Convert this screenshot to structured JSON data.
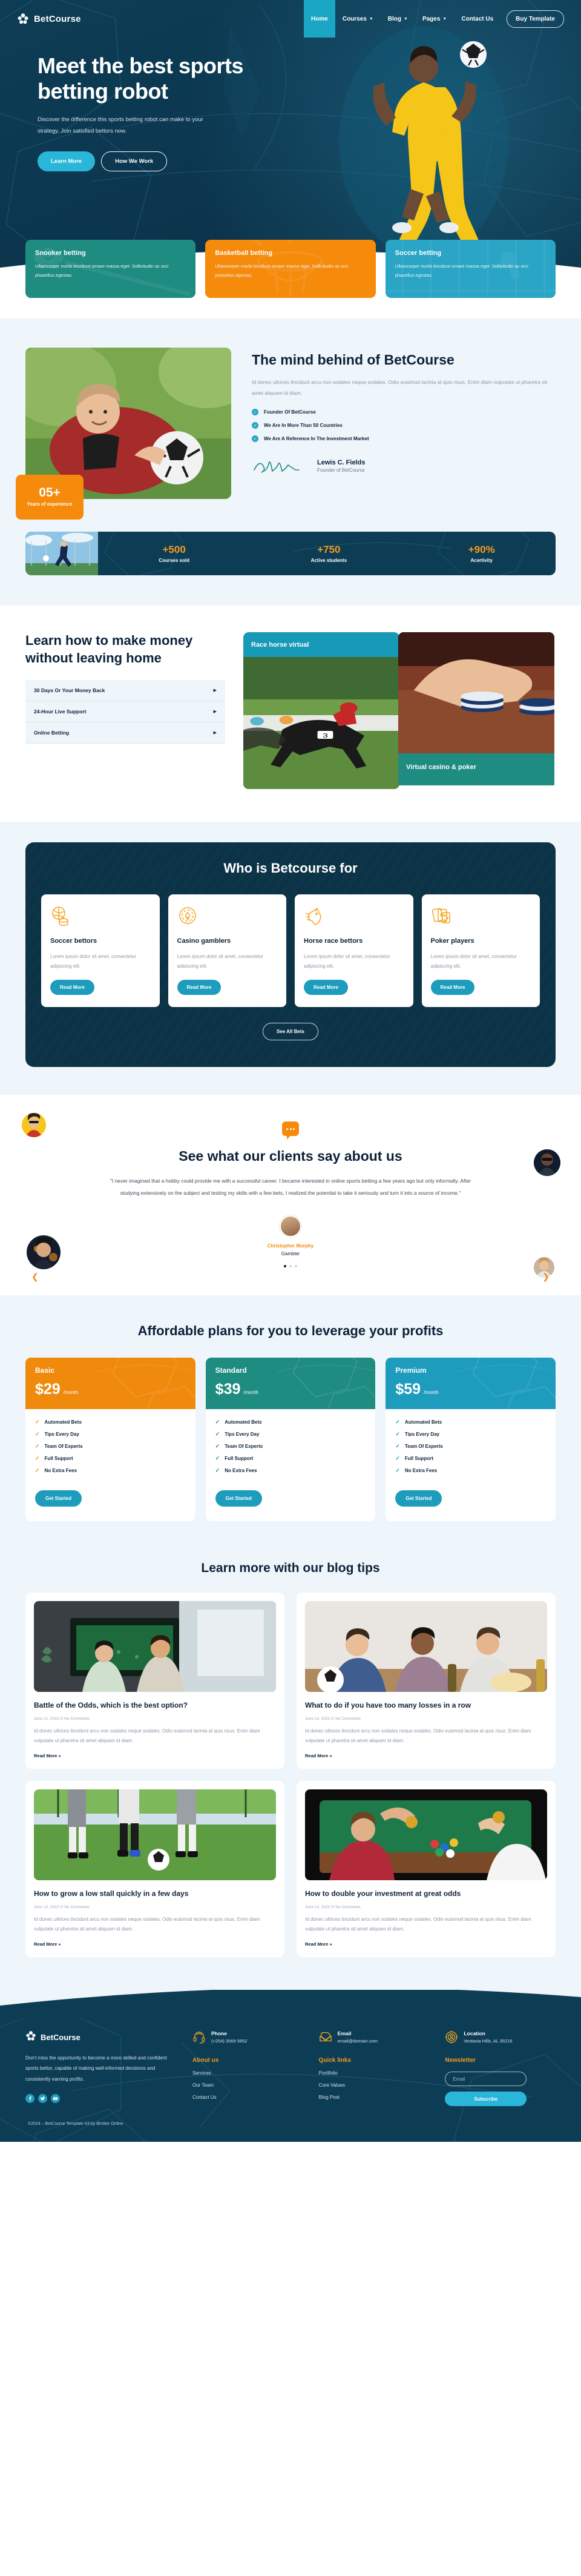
{
  "brand": {
    "name": "BetCourse",
    "logo_icon": "balls-cluster-icon"
  },
  "nav": {
    "items": [
      {
        "label": "Home",
        "active": true,
        "caret": false
      },
      {
        "label": "Courses",
        "active": false,
        "caret": true
      },
      {
        "label": "Blog",
        "active": false,
        "caret": true
      },
      {
        "label": "Pages",
        "active": false,
        "caret": true
      },
      {
        "label": "Contact Us",
        "active": false,
        "caret": false
      }
    ],
    "cta": "Buy Template"
  },
  "hero": {
    "title": "Meet the best sports betting robot",
    "subtitle": "Discover the difference this sports betting robot can make to your strategy. Join satisfied bettors now.",
    "primary_btn": "Learn More",
    "secondary_btn": "How We Work"
  },
  "categories": [
    {
      "title": "Snooker betting",
      "text": "Ullamcorper morbi tincidunt ornare massa eget. Sollicitudin ac orci phasellus egestas.",
      "color": "#1f8c81"
    },
    {
      "title": "Basketball betting",
      "text": "Ullamcorper morbi tincidunt ornare massa eget. Sollicitudin ac orci phasellus egestas.",
      "color": "#f58a0b"
    },
    {
      "title": "Soccer betting",
      "text": "Ullamcorper morbi tincidunt ornare massa eget. Sollicitudin ac orci phasellus egestas.",
      "color": "#2aa5c6"
    }
  ],
  "mind": {
    "title": "The mind behind of BetCourse",
    "lead": "Id donec ultrices tincidunt arcu non sodales neque sodales. Odio euismod lacinia at quis risus. Enim diam vulputate ut pharetra sit amet aliquam id diam.",
    "badge_number": "05+",
    "badge_label": "Years of experience",
    "checks": [
      "Founder Of BetCourse",
      "We Are In More Than 50 Countries",
      "We Are A Reference In The Investment Market"
    ],
    "signature_name": "Lewis C. Fields",
    "signature_role": "Founder of BetCourse"
  },
  "stats": [
    {
      "value": "+500",
      "label": "Courses sold"
    },
    {
      "value": "+750",
      "label": "Active students"
    },
    {
      "value": "+90%",
      "label": "Acertivity"
    }
  ],
  "learn": {
    "title": "Learn how to make money without leaving home",
    "accordion": [
      "30 Days Or Your Money Back",
      "24-Hour Live Support",
      "Online Betting"
    ],
    "tile_horse": "Race horse virtual",
    "tile_casino": "Virtual casino & poker"
  },
  "whofor": {
    "title": "Who is Betcourse for",
    "cards": [
      {
        "title": "Soccer bettors",
        "icon": "basketball-coins-icon",
        "text": "Lorem ipsum dolor sit amet, consectetur adipiscing elit.",
        "btn": "Read More"
      },
      {
        "title": "Casino gamblers",
        "icon": "casino-chip-icon",
        "text": "Lorem ipsum dolor sit amet, consectetur adipiscing elit.",
        "btn": "Read More"
      },
      {
        "title": "Horse race bettors",
        "icon": "horse-head-icon",
        "text": "Lorem ipsum dolor sit amet, consectetur adipiscing elit.",
        "btn": "Read More"
      },
      {
        "title": "Poker players",
        "icon": "playing-cards-icon",
        "text": "Lorem ipsum dolor sit amet, consectetur adipiscing elit.",
        "btn": "Read More"
      }
    ],
    "see_all": "See All Bets"
  },
  "testimonials": {
    "title": "See what our clients say about us",
    "quote": "\"I never imagined that a hobby could provide me with a successful career. I became interested in online sports betting a few years ago but only informally. After studying extensively on the subject and testing my skills with a few bets, I realized the potential to take it seriously and turn it into a source of income.\"",
    "author": "Christopher Murphy",
    "role": "Gambler",
    "prev_icon": "chevron-left-icon",
    "next_icon": "chevron-right-icon"
  },
  "pricing": {
    "title": "Affordable plans for you to leverage your profits",
    "plans": [
      {
        "name": "Basic",
        "price": "$29",
        "per": "/month",
        "color": "#f08a0c",
        "features": [
          "Automated Bets",
          "Tips Every Day",
          "Team Of Experts",
          "Full Support",
          "No Extra Fees"
        ],
        "btn": "Get Started"
      },
      {
        "name": "Standard",
        "price": "$39",
        "per": "/month",
        "color": "#1f8c81",
        "features": [
          "Automated Bets",
          "Tips Every Day",
          "Team Of Experts",
          "Full Support",
          "No Extra Fees"
        ],
        "btn": "Get Started"
      },
      {
        "name": "Premium",
        "price": "$59",
        "per": "/month",
        "color": "#1e9cbd",
        "features": [
          "Automated Bets",
          "Tips Every Day",
          "Team Of Experts",
          "Full Support",
          "No Extra Fees"
        ],
        "btn": "Get Started"
      }
    ]
  },
  "blog": {
    "title": "Learn more with our blog tips",
    "posts": [
      {
        "title": "Battle of the Odds, which is the best option?",
        "meta": "June 12, 2022 /// No Comments",
        "excerpt": "Id donec ultrices tincidunt arcu non sodales neque sodales. Odio euismod lacinia at quis risus. Enim diam vulputate ut pharetra sit amet aliquam id diam.",
        "link": "Read More »"
      },
      {
        "title": "What to do if you have too many losses in a row",
        "meta": "June 12, 2022 /// No Comments",
        "excerpt": "Id donec ultrices tincidunt arcu non sodales neque sodales. Odio euismod lacinia at quis risus. Enim diam vulputate ut pharetra sit amet aliquam id diam.",
        "link": "Read More »"
      },
      {
        "title": "How to grow a low stall quickly in a few days",
        "meta": "June 12, 2022 /// No Comments",
        "excerpt": "Id donec ultrices tincidunt arcu non sodales neque sodales. Odio euismod lacinia at quis risus. Enim diam vulputate ut pharetra sit amet aliquam id diam.",
        "link": "Read More »"
      },
      {
        "title": "How to double your investment at great odds",
        "meta": "June 12, 2022 /// No Comments",
        "excerpt": "Id donec ultrices tincidunt arcu non sodales neque sodales. Odio euismod lacinia at quis risus. Enim diam vulputate ut pharetra sit amet aliquam id diam.",
        "link": "Read More »"
      }
    ]
  },
  "footer": {
    "about": "Don't miss the opportunity to become a more skilled and confident sports bettor, capable of making well-informed decisions and consistently earning profits.",
    "socials": [
      "facebook-icon",
      "twitter-icon",
      "youtube-icon"
    ],
    "contacts": [
      {
        "label": "Phone",
        "value": "(+254) 3569 5852",
        "icon": "headset-icon"
      },
      {
        "label": "Email",
        "value": "email@domain.com",
        "icon": "envelope-icon"
      },
      {
        "label": "Location",
        "value": "Vestavia Hills, AL 35216",
        "icon": "location-target-icon"
      }
    ],
    "about_us_head": "About us",
    "about_us_links": [
      "Services",
      "Our Team",
      "Contact Us"
    ],
    "quick_links_head": "Quick links",
    "quick_links": [
      "Portifolio",
      "Core Values",
      "Blog Post"
    ],
    "newsletter_head": "Newsletter",
    "newsletter_placeholder": "Email",
    "newsletter_btn": "Subscribe",
    "copyright": "©2024 – BetCourse Template Kit by Bimber Online"
  }
}
